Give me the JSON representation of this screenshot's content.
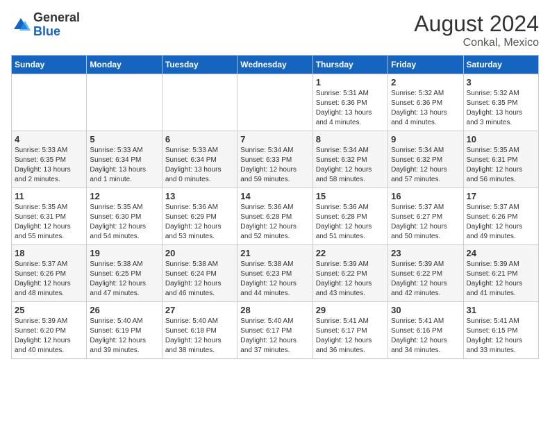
{
  "logo": {
    "general": "General",
    "blue": "Blue"
  },
  "title": "August 2024",
  "subtitle": "Conkal, Mexico",
  "days_of_week": [
    "Sunday",
    "Monday",
    "Tuesday",
    "Wednesday",
    "Thursday",
    "Friday",
    "Saturday"
  ],
  "weeks": [
    [
      {
        "day": "",
        "info": ""
      },
      {
        "day": "",
        "info": ""
      },
      {
        "day": "",
        "info": ""
      },
      {
        "day": "",
        "info": ""
      },
      {
        "day": "1",
        "info": "Sunrise: 5:31 AM\nSunset: 6:36 PM\nDaylight: 13 hours\nand 4 minutes."
      },
      {
        "day": "2",
        "info": "Sunrise: 5:32 AM\nSunset: 6:36 PM\nDaylight: 13 hours\nand 4 minutes."
      },
      {
        "day": "3",
        "info": "Sunrise: 5:32 AM\nSunset: 6:35 PM\nDaylight: 13 hours\nand 3 minutes."
      }
    ],
    [
      {
        "day": "4",
        "info": "Sunrise: 5:33 AM\nSunset: 6:35 PM\nDaylight: 13 hours\nand 2 minutes."
      },
      {
        "day": "5",
        "info": "Sunrise: 5:33 AM\nSunset: 6:34 PM\nDaylight: 13 hours\nand 1 minute."
      },
      {
        "day": "6",
        "info": "Sunrise: 5:33 AM\nSunset: 6:34 PM\nDaylight: 13 hours\nand 0 minutes."
      },
      {
        "day": "7",
        "info": "Sunrise: 5:34 AM\nSunset: 6:33 PM\nDaylight: 12 hours\nand 59 minutes."
      },
      {
        "day": "8",
        "info": "Sunrise: 5:34 AM\nSunset: 6:32 PM\nDaylight: 12 hours\nand 58 minutes."
      },
      {
        "day": "9",
        "info": "Sunrise: 5:34 AM\nSunset: 6:32 PM\nDaylight: 12 hours\nand 57 minutes."
      },
      {
        "day": "10",
        "info": "Sunrise: 5:35 AM\nSunset: 6:31 PM\nDaylight: 12 hours\nand 56 minutes."
      }
    ],
    [
      {
        "day": "11",
        "info": "Sunrise: 5:35 AM\nSunset: 6:31 PM\nDaylight: 12 hours\nand 55 minutes."
      },
      {
        "day": "12",
        "info": "Sunrise: 5:35 AM\nSunset: 6:30 PM\nDaylight: 12 hours\nand 54 minutes."
      },
      {
        "day": "13",
        "info": "Sunrise: 5:36 AM\nSunset: 6:29 PM\nDaylight: 12 hours\nand 53 minutes."
      },
      {
        "day": "14",
        "info": "Sunrise: 5:36 AM\nSunset: 6:28 PM\nDaylight: 12 hours\nand 52 minutes."
      },
      {
        "day": "15",
        "info": "Sunrise: 5:36 AM\nSunset: 6:28 PM\nDaylight: 12 hours\nand 51 minutes."
      },
      {
        "day": "16",
        "info": "Sunrise: 5:37 AM\nSunset: 6:27 PM\nDaylight: 12 hours\nand 50 minutes."
      },
      {
        "day": "17",
        "info": "Sunrise: 5:37 AM\nSunset: 6:26 PM\nDaylight: 12 hours\nand 49 minutes."
      }
    ],
    [
      {
        "day": "18",
        "info": "Sunrise: 5:37 AM\nSunset: 6:26 PM\nDaylight: 12 hours\nand 48 minutes."
      },
      {
        "day": "19",
        "info": "Sunrise: 5:38 AM\nSunset: 6:25 PM\nDaylight: 12 hours\nand 47 minutes."
      },
      {
        "day": "20",
        "info": "Sunrise: 5:38 AM\nSunset: 6:24 PM\nDaylight: 12 hours\nand 46 minutes."
      },
      {
        "day": "21",
        "info": "Sunrise: 5:38 AM\nSunset: 6:23 PM\nDaylight: 12 hours\nand 44 minutes."
      },
      {
        "day": "22",
        "info": "Sunrise: 5:39 AM\nSunset: 6:22 PM\nDaylight: 12 hours\nand 43 minutes."
      },
      {
        "day": "23",
        "info": "Sunrise: 5:39 AM\nSunset: 6:22 PM\nDaylight: 12 hours\nand 42 minutes."
      },
      {
        "day": "24",
        "info": "Sunrise: 5:39 AM\nSunset: 6:21 PM\nDaylight: 12 hours\nand 41 minutes."
      }
    ],
    [
      {
        "day": "25",
        "info": "Sunrise: 5:39 AM\nSunset: 6:20 PM\nDaylight: 12 hours\nand 40 minutes."
      },
      {
        "day": "26",
        "info": "Sunrise: 5:40 AM\nSunset: 6:19 PM\nDaylight: 12 hours\nand 39 minutes."
      },
      {
        "day": "27",
        "info": "Sunrise: 5:40 AM\nSunset: 6:18 PM\nDaylight: 12 hours\nand 38 minutes."
      },
      {
        "day": "28",
        "info": "Sunrise: 5:40 AM\nSunset: 6:17 PM\nDaylight: 12 hours\nand 37 minutes."
      },
      {
        "day": "29",
        "info": "Sunrise: 5:41 AM\nSunset: 6:17 PM\nDaylight: 12 hours\nand 36 minutes."
      },
      {
        "day": "30",
        "info": "Sunrise: 5:41 AM\nSunset: 6:16 PM\nDaylight: 12 hours\nand 34 minutes."
      },
      {
        "day": "31",
        "info": "Sunrise: 5:41 AM\nSunset: 6:15 PM\nDaylight: 12 hours\nand 33 minutes."
      }
    ]
  ]
}
